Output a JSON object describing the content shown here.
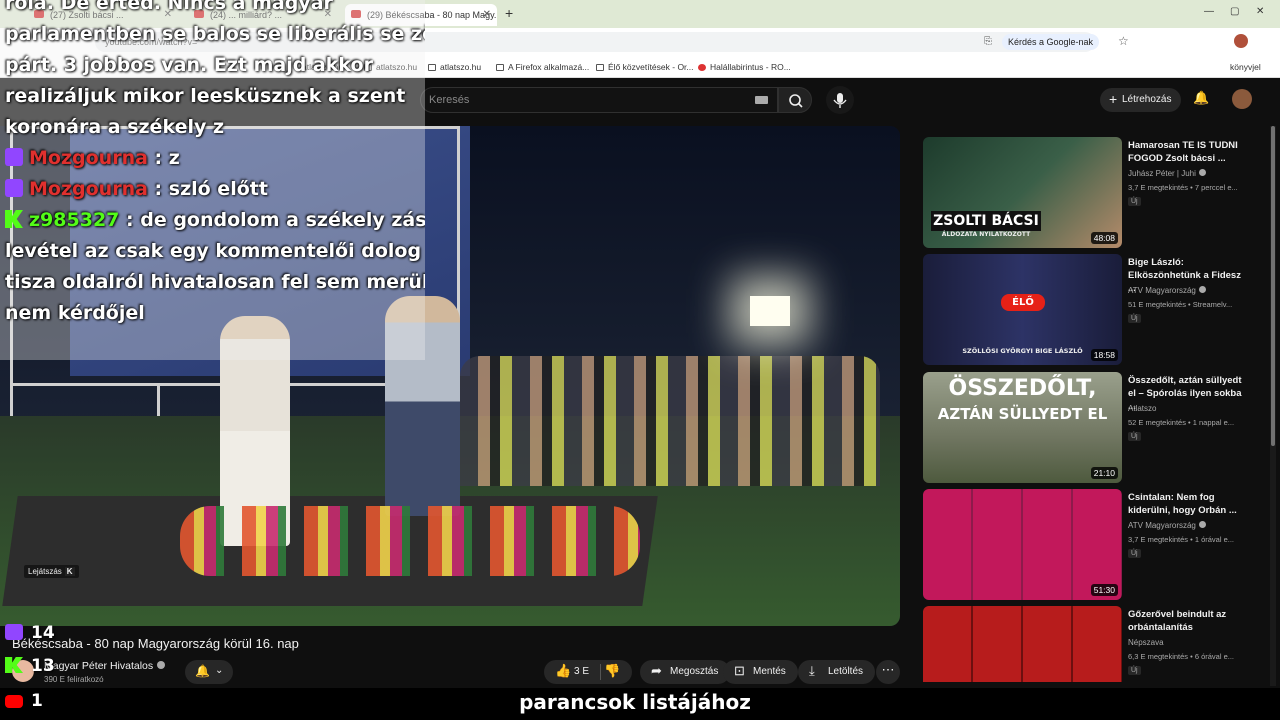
{
  "browser": {
    "tabs": [
      {
        "label": "(27) Zsolti bácsi ...",
        "active": false
      },
      {
        "label": "(24) ... milliárd? ...",
        "active": false
      },
      {
        "label": "(29) Békéscsaba - 80 nap Magy...",
        "active": true
      }
    ],
    "url": "youtube.com/watch?v=",
    "ask_google": "Kérdés a Google-nak",
    "bookmarks": [
      "atlatszo.hu",
      "atlatszo.hu",
      "atlatszo.hu",
      "A Firefox alkalmazá...",
      "Élő közvetítések - Or...",
      "Halállabirintus - RO...",
      "könyvjel"
    ]
  },
  "youtube": {
    "search_placeholder": "Keresés",
    "create_label": "Létrehozás"
  },
  "chat": [
    {
      "text": "rola. De érted. Nincs a magyar"
    },
    {
      "text": "parlamentben se balos se liberális se zöld"
    },
    {
      "text": "párt. 3 jobbos van. Ezt majd akkor"
    },
    {
      "text": "realizáljuk mikor leesküsznek a szent"
    },
    {
      "text": "koronára a székely z"
    },
    {
      "platform": "twitch",
      "user": "Mozgourna",
      "msg": ": z"
    },
    {
      "platform": "twitch",
      "user": "Mozgourna",
      "msg": ": szló előtt"
    },
    {
      "platform": "kick",
      "user": "z985327",
      "msg": ": de gondolom a székely zászló"
    },
    {
      "text": "levétel az csak egy kommentelői dolog volt,"
    },
    {
      "text": "tisza oldalról hivatalosan fel sem merült,"
    },
    {
      "text": "nem kérdőjel"
    }
  ],
  "player": {
    "play_badge": "Lejátszás",
    "play_key": "K"
  },
  "video": {
    "title": "Békéscsaba - 80 nap Magyarország körül 16. nap",
    "channel": "Magyar Péter Hivatalos",
    "subscribers": "390 E feliratkozó",
    "like_count": "3 E",
    "share": "Megosztás",
    "save": "Mentés",
    "download": "Letöltés"
  },
  "counters": [
    {
      "platform": "twitch",
      "value": "14"
    },
    {
      "platform": "kick",
      "value": "13"
    },
    {
      "platform": "youtube",
      "value": "1"
    }
  ],
  "caption": "parancsok listájához",
  "recommendations": [
    {
      "title": "Hamarosan TE IS TUDNI FOGOD Zsolt bácsi ...",
      "channel": "Juhász Péter | Juhi",
      "meta": "3,7 E megtekintés • 7 perccel e...",
      "badge": "Új",
      "duration": "48:08",
      "thumb_text": "ZSOLTI BÁCSI",
      "thumb_sub": "ÁLDOZATA NYILATKOZOTT"
    },
    {
      "title": "Bige László: Elköszönhetünk a Fidesz ...",
      "channel": "ATV Magyarország",
      "meta": "51 E megtekintés • Streamelv...",
      "badge": "Új",
      "duration": "18:58",
      "thumb_text": "ÉLŐ",
      "thumb_sub": "SZÖLLŐSI GYÖRGYI   BIGE LÁSZLÓ"
    },
    {
      "title": "Összedőlt, aztán süllyedt el – Spórolás ilyen sokba ...",
      "channel": "Atlatszo",
      "meta": "52 E megtekintés • 1 nappal e...",
      "badge": "Új",
      "duration": "21:10",
      "thumb_text": "ÖSSZEDŐLT,",
      "thumb_sub": "AZTÁN SÜLLYEDT EL"
    },
    {
      "title": "Csintalan: Nem fog kiderülni, hogy Orbán ...",
      "channel": "ATV Magyarország",
      "meta": "3,7 E megtekintés • 1 órával e...",
      "badge": "Új",
      "duration": "51:30",
      "thumb_text": "",
      "thumb_sub": ""
    },
    {
      "title": "Gőzerővel beindult az orbántalanítás",
      "channel": "Népszava",
      "meta": "6,3 E megtekintés • 6 órával e...",
      "badge": "Új",
      "duration": "",
      "thumb_text": "",
      "thumb_sub": ""
    }
  ]
}
